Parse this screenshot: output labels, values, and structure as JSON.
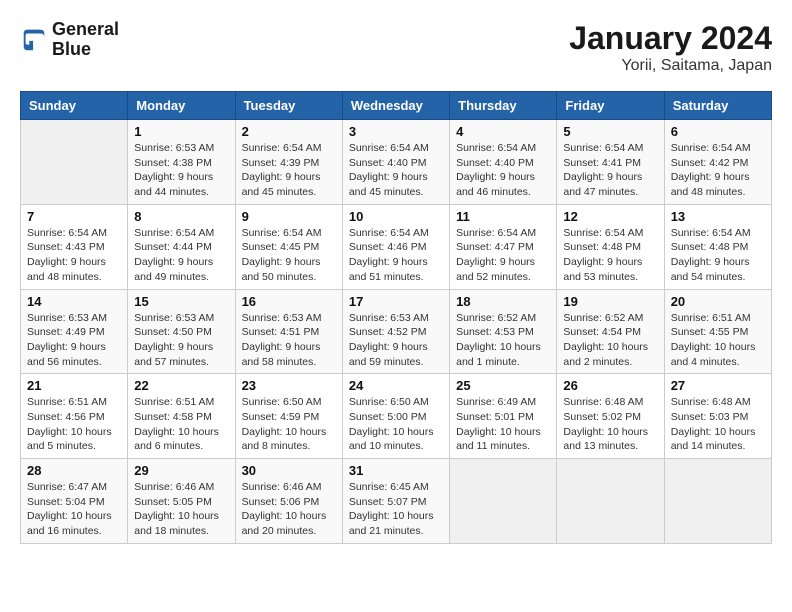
{
  "logo": {
    "line1": "General",
    "line2": "Blue"
  },
  "title": "January 2024",
  "subtitle": "Yorii, Saitama, Japan",
  "days_header": [
    "Sunday",
    "Monday",
    "Tuesday",
    "Wednesday",
    "Thursday",
    "Friday",
    "Saturday"
  ],
  "weeks": [
    [
      {
        "num": "",
        "info": ""
      },
      {
        "num": "1",
        "info": "Sunrise: 6:53 AM\nSunset: 4:38 PM\nDaylight: 9 hours\nand 44 minutes."
      },
      {
        "num": "2",
        "info": "Sunrise: 6:54 AM\nSunset: 4:39 PM\nDaylight: 9 hours\nand 45 minutes."
      },
      {
        "num": "3",
        "info": "Sunrise: 6:54 AM\nSunset: 4:40 PM\nDaylight: 9 hours\nand 45 minutes."
      },
      {
        "num": "4",
        "info": "Sunrise: 6:54 AM\nSunset: 4:40 PM\nDaylight: 9 hours\nand 46 minutes."
      },
      {
        "num": "5",
        "info": "Sunrise: 6:54 AM\nSunset: 4:41 PM\nDaylight: 9 hours\nand 47 minutes."
      },
      {
        "num": "6",
        "info": "Sunrise: 6:54 AM\nSunset: 4:42 PM\nDaylight: 9 hours\nand 48 minutes."
      }
    ],
    [
      {
        "num": "7",
        "info": "Sunrise: 6:54 AM\nSunset: 4:43 PM\nDaylight: 9 hours\nand 48 minutes."
      },
      {
        "num": "8",
        "info": "Sunrise: 6:54 AM\nSunset: 4:44 PM\nDaylight: 9 hours\nand 49 minutes."
      },
      {
        "num": "9",
        "info": "Sunrise: 6:54 AM\nSunset: 4:45 PM\nDaylight: 9 hours\nand 50 minutes."
      },
      {
        "num": "10",
        "info": "Sunrise: 6:54 AM\nSunset: 4:46 PM\nDaylight: 9 hours\nand 51 minutes."
      },
      {
        "num": "11",
        "info": "Sunrise: 6:54 AM\nSunset: 4:47 PM\nDaylight: 9 hours\nand 52 minutes."
      },
      {
        "num": "12",
        "info": "Sunrise: 6:54 AM\nSunset: 4:48 PM\nDaylight: 9 hours\nand 53 minutes."
      },
      {
        "num": "13",
        "info": "Sunrise: 6:54 AM\nSunset: 4:48 PM\nDaylight: 9 hours\nand 54 minutes."
      }
    ],
    [
      {
        "num": "14",
        "info": "Sunrise: 6:53 AM\nSunset: 4:49 PM\nDaylight: 9 hours\nand 56 minutes."
      },
      {
        "num": "15",
        "info": "Sunrise: 6:53 AM\nSunset: 4:50 PM\nDaylight: 9 hours\nand 57 minutes."
      },
      {
        "num": "16",
        "info": "Sunrise: 6:53 AM\nSunset: 4:51 PM\nDaylight: 9 hours\nand 58 minutes."
      },
      {
        "num": "17",
        "info": "Sunrise: 6:53 AM\nSunset: 4:52 PM\nDaylight: 9 hours\nand 59 minutes."
      },
      {
        "num": "18",
        "info": "Sunrise: 6:52 AM\nSunset: 4:53 PM\nDaylight: 10 hours\nand 1 minute."
      },
      {
        "num": "19",
        "info": "Sunrise: 6:52 AM\nSunset: 4:54 PM\nDaylight: 10 hours\nand 2 minutes."
      },
      {
        "num": "20",
        "info": "Sunrise: 6:51 AM\nSunset: 4:55 PM\nDaylight: 10 hours\nand 4 minutes."
      }
    ],
    [
      {
        "num": "21",
        "info": "Sunrise: 6:51 AM\nSunset: 4:56 PM\nDaylight: 10 hours\nand 5 minutes."
      },
      {
        "num": "22",
        "info": "Sunrise: 6:51 AM\nSunset: 4:58 PM\nDaylight: 10 hours\nand 6 minutes."
      },
      {
        "num": "23",
        "info": "Sunrise: 6:50 AM\nSunset: 4:59 PM\nDaylight: 10 hours\nand 8 minutes."
      },
      {
        "num": "24",
        "info": "Sunrise: 6:50 AM\nSunset: 5:00 PM\nDaylight: 10 hours\nand 10 minutes."
      },
      {
        "num": "25",
        "info": "Sunrise: 6:49 AM\nSunset: 5:01 PM\nDaylight: 10 hours\nand 11 minutes."
      },
      {
        "num": "26",
        "info": "Sunrise: 6:48 AM\nSunset: 5:02 PM\nDaylight: 10 hours\nand 13 minutes."
      },
      {
        "num": "27",
        "info": "Sunrise: 6:48 AM\nSunset: 5:03 PM\nDaylight: 10 hours\nand 14 minutes."
      }
    ],
    [
      {
        "num": "28",
        "info": "Sunrise: 6:47 AM\nSunset: 5:04 PM\nDaylight: 10 hours\nand 16 minutes."
      },
      {
        "num": "29",
        "info": "Sunrise: 6:46 AM\nSunset: 5:05 PM\nDaylight: 10 hours\nand 18 minutes."
      },
      {
        "num": "30",
        "info": "Sunrise: 6:46 AM\nSunset: 5:06 PM\nDaylight: 10 hours\nand 20 minutes."
      },
      {
        "num": "31",
        "info": "Sunrise: 6:45 AM\nSunset: 5:07 PM\nDaylight: 10 hours\nand 21 minutes."
      },
      {
        "num": "",
        "info": ""
      },
      {
        "num": "",
        "info": ""
      },
      {
        "num": "",
        "info": ""
      }
    ]
  ]
}
